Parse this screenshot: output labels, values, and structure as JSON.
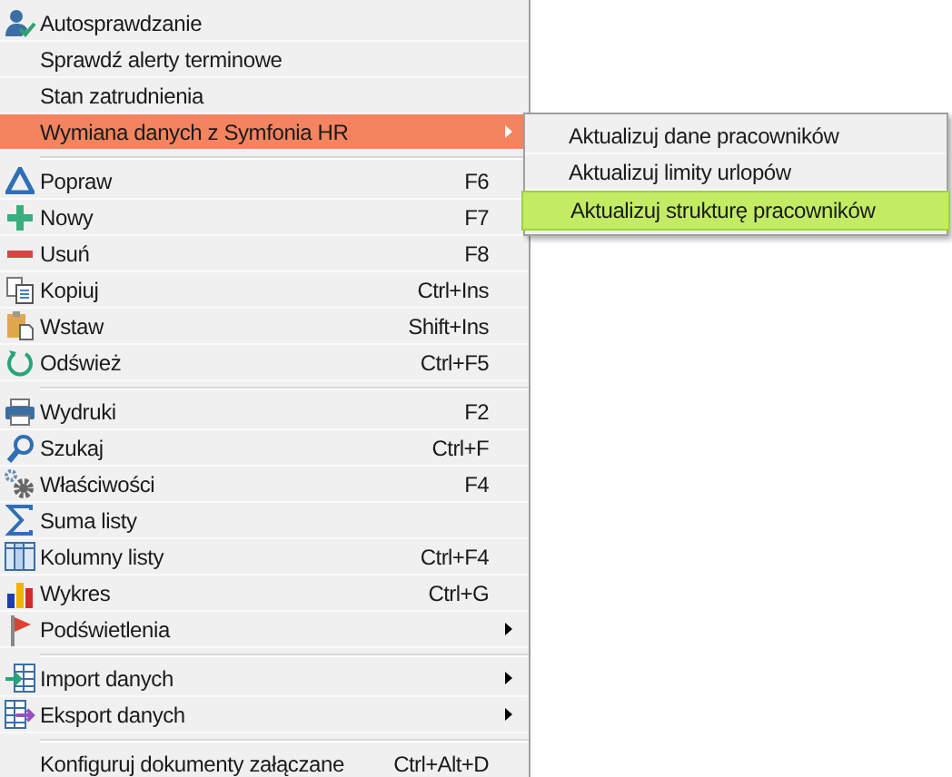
{
  "menu": {
    "groups": [
      [
        {
          "label": "Autosprawdzanie",
          "selected": false,
          "submenu": false
        },
        {
          "label": "Sprawdź alerty terminowe",
          "selected": false,
          "submenu": false
        },
        {
          "label": "Stan zatrudnienia",
          "selected": false,
          "submenu": false
        },
        {
          "label": "Wymiana danych z Symfonia HR",
          "selected": true,
          "submenu": true
        }
      ],
      [
        {
          "label": "Popraw",
          "shortcut": "F6",
          "selected": false,
          "submenu": false
        },
        {
          "label": "Nowy",
          "shortcut": "F7",
          "selected": false,
          "submenu": false
        },
        {
          "label": "Usuń",
          "shortcut": "F8",
          "selected": false,
          "submenu": false
        },
        {
          "label": "Kopiuj",
          "shortcut": "Ctrl+Ins",
          "selected": false,
          "submenu": false
        },
        {
          "label": "Wstaw",
          "shortcut": "Shift+Ins",
          "selected": false,
          "submenu": false
        },
        {
          "label": "Odśwież",
          "shortcut": "Ctrl+F5",
          "selected": false,
          "submenu": false
        }
      ],
      [
        {
          "label": "Wydruki",
          "shortcut": "F2",
          "selected": false,
          "submenu": false
        },
        {
          "label": "Szukaj",
          "shortcut": "Ctrl+F",
          "selected": false,
          "submenu": false
        },
        {
          "label": "Właściwości",
          "shortcut": "F4",
          "selected": false,
          "submenu": false
        },
        {
          "label": "Suma listy",
          "selected": false,
          "submenu": false
        },
        {
          "label": "Kolumny listy",
          "shortcut": "Ctrl+F4",
          "selected": false,
          "submenu": false
        },
        {
          "label": "Wykres",
          "shortcut": "Ctrl+G",
          "selected": false,
          "submenu": false
        },
        {
          "label": "Podświetlenia",
          "selected": false,
          "submenu": true
        }
      ],
      [
        {
          "label": "Import danych",
          "selected": false,
          "submenu": true
        },
        {
          "label": "Eksport danych",
          "selected": false,
          "submenu": true
        }
      ],
      [
        {
          "label": "Konfiguruj dokumenty załączane",
          "shortcut": "Ctrl+Alt+D",
          "selected": false,
          "submenu": false
        }
      ]
    ]
  },
  "submenu": {
    "items": [
      {
        "label": "Aktualizuj dane pracowników",
        "selected": false
      },
      {
        "label": "Aktualizuj limity urlopów",
        "selected": false
      },
      {
        "label": "Aktualizuj strukturę pracowników",
        "selected": true
      }
    ]
  }
}
